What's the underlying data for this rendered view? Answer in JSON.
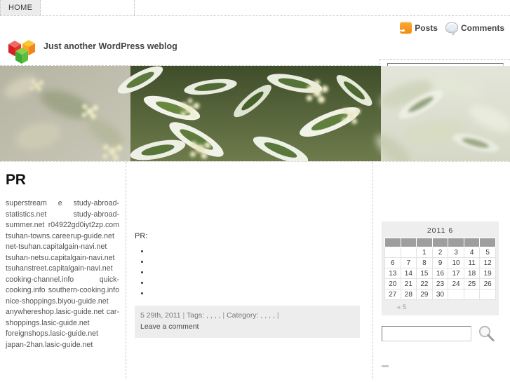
{
  "topnav": {
    "items": [
      {
        "label": "HOME"
      }
    ]
  },
  "header": {
    "site_title": "Just another WordPress weblog",
    "logo_icon": "three-cubes-logo",
    "feeds": [
      {
        "icon": "rss-icon",
        "label": "Posts"
      },
      {
        "icon": "comment-bubble-icon",
        "label": "Comments"
      }
    ],
    "search": {
      "value": "",
      "placeholder": ""
    }
  },
  "hero": {
    "alt": "variegated green and white foliage with cream flower clusters",
    "colors": {
      "leaf_dark": "#4c5c32",
      "leaf_mid": "#8d9a6b",
      "leaf_light": "#e9ecdf",
      "flower": "#e8e6c8",
      "bg_blur": "#b9b8a6"
    }
  },
  "sidebar_left": {
    "title": "PR",
    "links_text": "superstream e study-abroad-statistics.net study-abroad-summer.net r04922gd0iyt2zp.com tsuhan-towns.careerup-guide.net net-tsuhan.capitalgain-navi.net tsuhan-netsu.capitalgain-navi.net tsuhanstreet.capitalgain-navi.net cooking-channel.info quick-cooking.info southern-cooking.info nice-shoppings.biyou-guide.net anywhereshop.lasic-guide.net car-shoppings.lasic-guide.net foreignshops.lasic-guide.net japan-2han.lasic-guide.net"
  },
  "main": {
    "post_lead": "PR:",
    "post_items": [
      "",
      "",
      "",
      "",
      ""
    ],
    "meta": {
      "date": "5  29th, 2011",
      "sep": "|",
      "tags_label": "Tags:",
      "tags": ",  ,  ,  ,",
      "category_label": "Category:",
      "categories": ",       ,      ,    ,",
      "comment_link": "Leave a comment"
    }
  },
  "sidebar_right": {
    "calendar": {
      "caption": "2011  6",
      "weekday_headers": [
        "",
        "",
        "",
        "",
        "",
        "",
        ""
      ],
      "weeks": [
        [
          "",
          "",
          "1",
          "2",
          "3",
          "4",
          "5"
        ],
        [
          "6",
          "7",
          "8",
          "9",
          "10",
          "11",
          "12"
        ],
        [
          "13",
          "14",
          "15",
          "16",
          "17",
          "18",
          "19"
        ],
        [
          "20",
          "21",
          "22",
          "23",
          "24",
          "25",
          "26"
        ],
        [
          "27",
          "28",
          "29",
          "30",
          "",
          "",
          ""
        ]
      ],
      "prev_link": "« 5"
    },
    "search": {
      "value": "",
      "placeholder": ""
    },
    "search_icon": "magnifier-icon"
  },
  "colors": {
    "accent_orange": "#f39c12",
    "dashed_border": "#c8c8c8",
    "meta_bg": "#ededed",
    "calendar_bg": "#eeeeee",
    "calendar_header": "#9e9e9e"
  }
}
